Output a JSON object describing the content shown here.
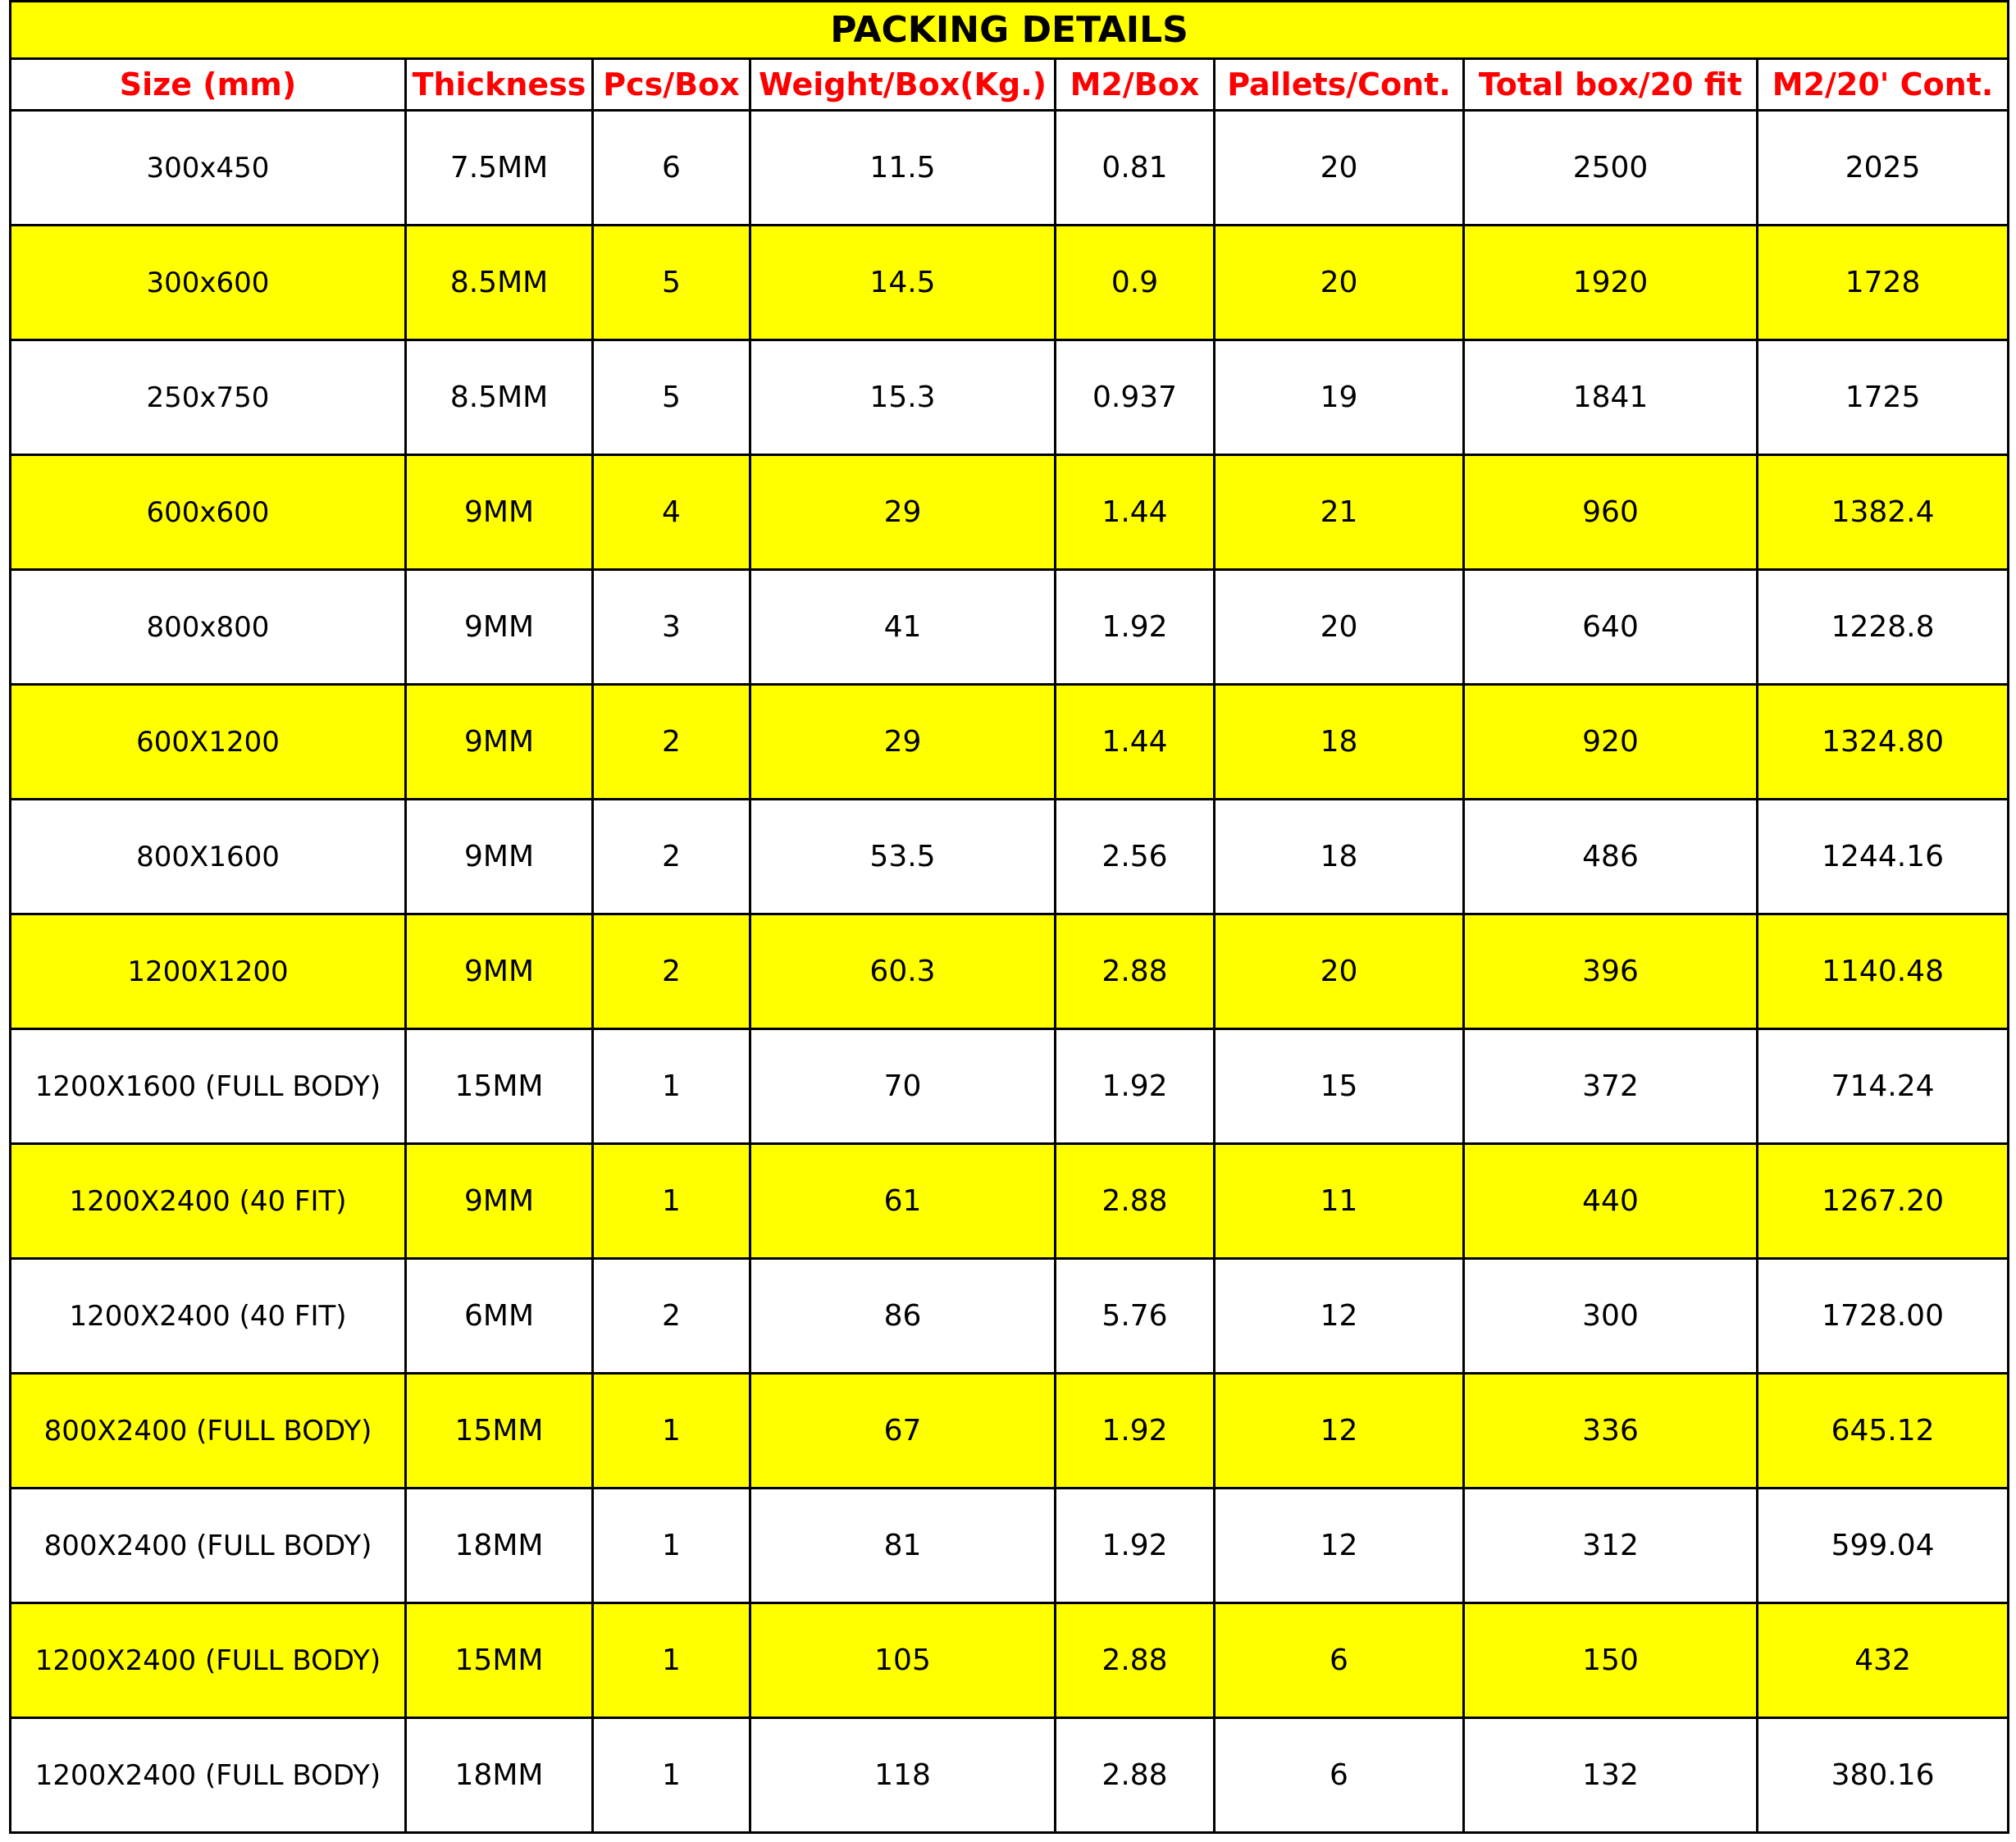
{
  "title": "PACKING DETAILS",
  "colors": {
    "highlight": "#ffff00",
    "header_text": "#ff0000",
    "text": "#000000",
    "border": "#000000"
  },
  "columns": [
    "Size (mm)",
    "Thickness",
    "Pcs/Box",
    "Weight/Box(Kg.)",
    "M2/Box",
    "Pallets/Cont.",
    "Total box/20 fit",
    "M2/20' Cont."
  ],
  "rows": [
    {
      "size": "300x450",
      "thickness": "7.5MM",
      "pcs": "6",
      "weight": "11.5",
      "m2box": "0.81",
      "pallets": "20",
      "total": "2500",
      "m2cont": "2025",
      "highlight": false
    },
    {
      "size": "300x600",
      "thickness": "8.5MM",
      "pcs": "5",
      "weight": "14.5",
      "m2box": "0.9",
      "pallets": "20",
      "total": "1920",
      "m2cont": "1728",
      "highlight": true
    },
    {
      "size": "250x750",
      "thickness": "8.5MM",
      "pcs": "5",
      "weight": "15.3",
      "m2box": "0.937",
      "pallets": "19",
      "total": "1841",
      "m2cont": "1725",
      "highlight": false
    },
    {
      "size": "600x600",
      "thickness": "9MM",
      "pcs": "4",
      "weight": "29",
      "m2box": "1.44",
      "pallets": "21",
      "total": "960",
      "m2cont": "1382.4",
      "highlight": true
    },
    {
      "size": "800x800",
      "thickness": "9MM",
      "pcs": "3",
      "weight": "41",
      "m2box": "1.92",
      "pallets": "20",
      "total": "640",
      "m2cont": "1228.8",
      "highlight": false
    },
    {
      "size": "600X1200",
      "thickness": "9MM",
      "pcs": "2",
      "weight": "29",
      "m2box": "1.44",
      "pallets": "18",
      "total": "920",
      "m2cont": "1324.80",
      "highlight": true
    },
    {
      "size": "800X1600",
      "thickness": "9MM",
      "pcs": "2",
      "weight": "53.5",
      "m2box": "2.56",
      "pallets": "18",
      "total": "486",
      "m2cont": "1244.16",
      "highlight": false
    },
    {
      "size": "1200X1200",
      "thickness": "9MM",
      "pcs": "2",
      "weight": "60.3",
      "m2box": "2.88",
      "pallets": "20",
      "total": "396",
      "m2cont": "1140.48",
      "highlight": true
    },
    {
      "size": "1200X1600 (FULL BODY)",
      "thickness": "15MM",
      "pcs": "1",
      "weight": "70",
      "m2box": "1.92",
      "pallets": "15",
      "total": "372",
      "m2cont": "714.24",
      "highlight": false
    },
    {
      "size": "1200X2400 (40 FIT)",
      "thickness": "9MM",
      "pcs": "1",
      "weight": "61",
      "m2box": "2.88",
      "pallets": "11",
      "total": "440",
      "m2cont": "1267.20",
      "highlight": true
    },
    {
      "size": "1200X2400 (40 FIT)",
      "thickness": "6MM",
      "pcs": "2",
      "weight": "86",
      "m2box": "5.76",
      "pallets": "12",
      "total": "300",
      "m2cont": "1728.00",
      "highlight": false
    },
    {
      "size": "800X2400 (FULL BODY)",
      "thickness": "15MM",
      "pcs": "1",
      "weight": "67",
      "m2box": "1.92",
      "pallets": "12",
      "total": "336",
      "m2cont": "645.12",
      "highlight": true
    },
    {
      "size": "800X2400 (FULL BODY)",
      "thickness": "18MM",
      "pcs": "1",
      "weight": "81",
      "m2box": "1.92",
      "pallets": "12",
      "total": "312",
      "m2cont": "599.04",
      "highlight": false
    },
    {
      "size": "1200X2400 (FULL BODY)",
      "thickness": "15MM",
      "pcs": "1",
      "weight": "105",
      "m2box": "2.88",
      "pallets": "6",
      "total": "150",
      "m2cont": "432",
      "highlight": true
    },
    {
      "size": "1200X2400 (FULL BODY)",
      "thickness": "18MM",
      "pcs": "1",
      "weight": "118",
      "m2box": "2.88",
      "pallets": "6",
      "total": "132",
      "m2cont": "380.16",
      "highlight": false
    }
  ]
}
